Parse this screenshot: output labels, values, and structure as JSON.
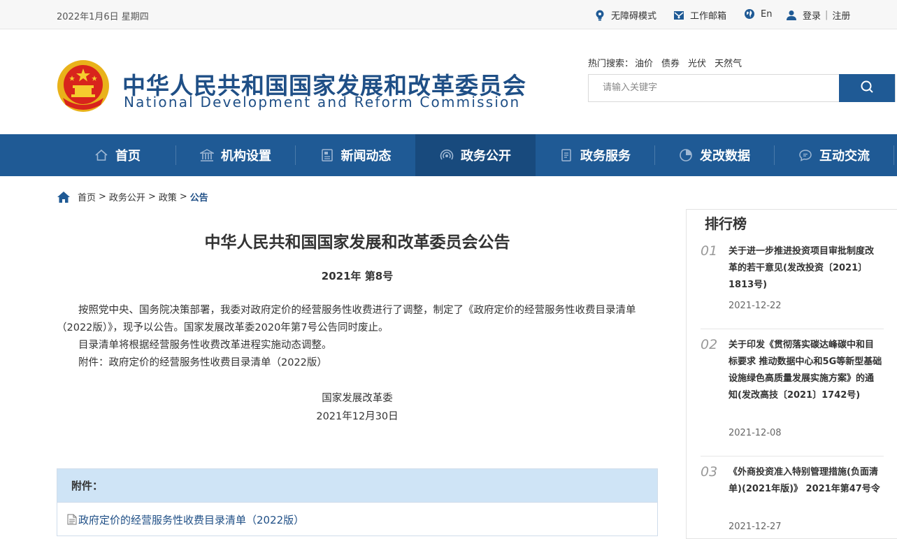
{
  "topbar": {
    "date": "2022年1月6日 星期四",
    "accessibility": "无障碍模式",
    "mailbox": "工作邮箱",
    "language": "En",
    "login": "登录",
    "separator": "|",
    "register": "注册"
  },
  "header": {
    "title_cn": "中华人民共和国国家发展和改革委员会",
    "title_en": "National Development and Reform Commission",
    "hot_label": "热门搜索：",
    "hot_keywords": [
      "油价",
      "债券",
      "光伏",
      "天然气"
    ],
    "search_placeholder": "请输入关键字"
  },
  "nav": [
    {
      "label": "首页",
      "icon": "home-icon"
    },
    {
      "label": "机构设置",
      "icon": "building-icon"
    },
    {
      "label": "新闻动态",
      "icon": "news-icon"
    },
    {
      "label": "政务公开",
      "icon": "broadcast-icon",
      "active": true
    },
    {
      "label": "政务服务",
      "icon": "document-icon"
    },
    {
      "label": "发改数据",
      "icon": "pie-chart-icon"
    },
    {
      "label": "互动交流",
      "icon": "chat-icon"
    }
  ],
  "breadcrumb": [
    "首页",
    "政务公开",
    "政策",
    "公告"
  ],
  "article": {
    "title": "中华人民共和国国家发展和改革委员会公告",
    "number": "2021年 第8号",
    "p1": "按照党中央、国务院决策部署，我委对政府定价的经营服务性收费进行了调整，制定了《政府定价的经营服务性收费目录清单（2022版）》，现予以公告。国家发展改革委2020年第7号公告同时废止。",
    "p2": "目录清单将根据经营服务性收费改革进程实施动态调整。",
    "p3": "附件：政府定价的经营服务性收费目录清单（2022版）",
    "signer": "国家发展改革委",
    "sign_date": "2021年12月30日",
    "attach_label": "附件：",
    "attach_link": "政府定价的经营服务性收费目录清单（2022版）"
  },
  "ranking": {
    "title": "排行榜",
    "items": [
      {
        "num": "01",
        "text": "关于进一步推进投资项目审批制度改革的若干意见(发改投资〔2021〕1813号)",
        "date": "2021-12-22"
      },
      {
        "num": "02",
        "text": "关于印发《贯彻落实碳达峰碳中和目标要求 推动数据中心和5G等新型基础设施绿色高质量发展实施方案》的通知(发改高技〔2021〕1742号)",
        "date": "2021-12-08"
      },
      {
        "num": "03",
        "text": "《外商投资准入特别管理措施(负面清单)(2021年版)》 2021年第47号令",
        "date": "2021-12-27"
      }
    ]
  },
  "colors": {
    "brand": "#1f5a95",
    "brand_dark": "#184a7d",
    "title_blue": "#1f4f86",
    "attach_header": "#cfe4f6"
  }
}
